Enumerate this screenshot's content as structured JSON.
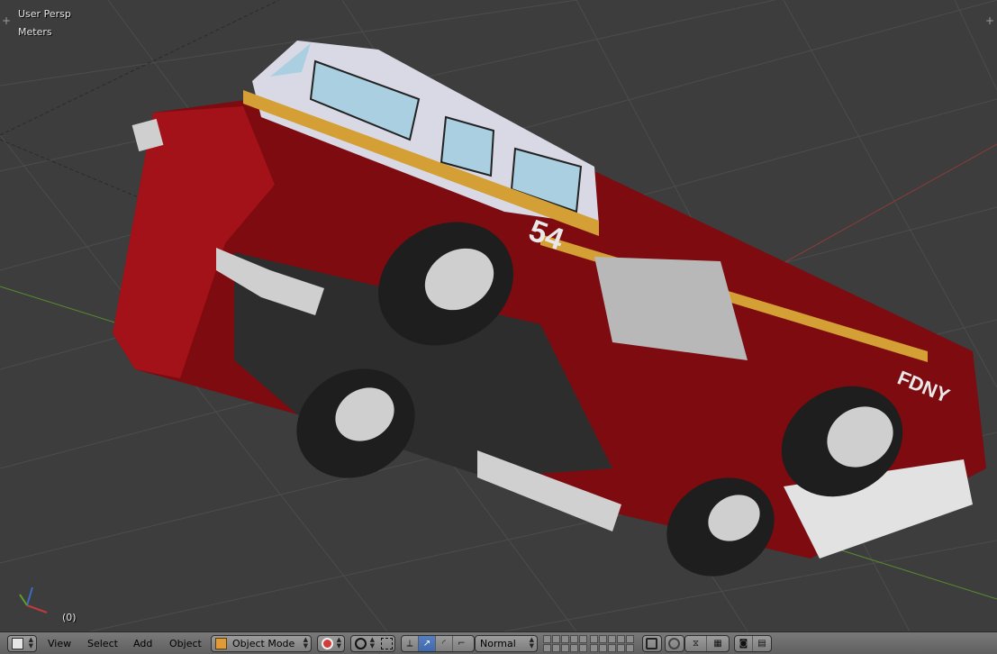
{
  "viewport": {
    "view_name": "User Persp",
    "units": "Meters",
    "frame": "(0)",
    "truck_number": "54",
    "truck_text": "FDNY"
  },
  "header": {
    "menus": [
      "View",
      "Select",
      "Add",
      "Object"
    ],
    "mode": "Object Mode",
    "orientation": "Normal",
    "icons": {
      "editor_type": "3d-view-icon",
      "shading": "viewport-shading-icon",
      "pivot": "pivot-point-icon",
      "manipulator": "manipulator-icon",
      "translate": "translate-manipulator-icon",
      "rotate": "rotate-manipulator-icon",
      "scale": "scale-manipulator-icon",
      "layers": "scene-layers",
      "lock_layers": "lock-layers-icon",
      "proportional": "proportional-edit-icon",
      "snap": "snap-icon",
      "snap_target": "snap-target-icon",
      "render": "opengl-render-icon",
      "render_anim": "opengl-animation-icon"
    }
  },
  "colors": {
    "viewport_bg": "#3d3d3d",
    "grid_line": "#4d4d4d",
    "x_axis": "#8c3b3b",
    "y_axis": "#5a8c2e",
    "truck_red": "#9c0f14",
    "header_bg": "#6e6e6e",
    "active_blue": "#4a76ba"
  }
}
